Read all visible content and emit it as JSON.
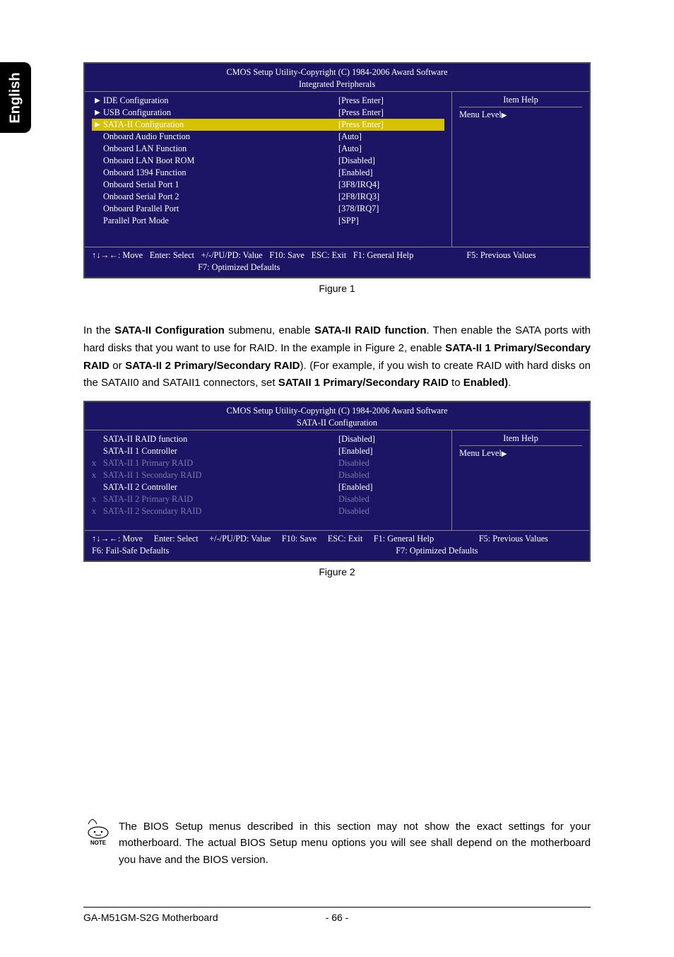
{
  "sideTab": "English",
  "bios1": {
    "title1": "CMOS Setup Utility-Copyright (C) 1984-2006 Award Software",
    "title2": "Integrated Peripherals",
    "rows": [
      {
        "arrow": "▶",
        "label": "IDE Configuration",
        "value": "[Press Enter]"
      },
      {
        "arrow": "▶",
        "label": "USB Configuration",
        "value": "[Press Enter]"
      },
      {
        "arrow": "▶",
        "label": "SATA-II Configuration",
        "value": "[Press Enter]",
        "hl": true
      },
      {
        "arrow": "",
        "label": "Onboard Audio Function",
        "value": "[Auto]"
      },
      {
        "arrow": "",
        "label": "Onboard LAN Function",
        "value": "[Auto]"
      },
      {
        "arrow": "",
        "label": "Onboard LAN Boot ROM",
        "value": "[Disabled]"
      },
      {
        "arrow": "",
        "label": "Onboard 1394 Function",
        "value": "[Enabled]"
      },
      {
        "arrow": "",
        "label": "Onboard Serial Port 1",
        "value": "[3F8/IRQ4]"
      },
      {
        "arrow": "",
        "label": "Onboard Serial Port 2",
        "value": "[2F8/IRQ3]"
      },
      {
        "arrow": "",
        "label": "Onboard Parallel Port",
        "value": "[378/IRQ7]"
      },
      {
        "arrow": "",
        "label": "Parallel Port Mode",
        "value": "[SPP]"
      }
    ],
    "help1": "Item Help",
    "help2": "Menu Level",
    "foot": {
      "move": "↑↓→←: Move",
      "enter": "Enter: Select",
      "pupd": "+/-/PU/PD: Value",
      "f10": "F10: Save",
      "esc": "ESC: Exit",
      "f1": "F1: General Help",
      "f5": "F5: Previous Values",
      "f7": "F7: Optimized Defaults"
    }
  },
  "caption1": "Figure 1",
  "para1": {
    "t1": "In the ",
    "b1": "SATA-II Configuration",
    "t2": " submenu, enable ",
    "b2": "SATA-II RAID function",
    "t3": ". Then enable the SATA ports with hard disks that you want to use for RAID. In the example in Figure 2, enable ",
    "b3": "SATA-II 1 Primary/Secondary RAID",
    "t4": " or ",
    "b4": "SATA-II 2 Primary/Secondary RAID",
    "t5": "). (For example, if you wish to create RAID with hard disks on the SATAII0 and SATAII1 connectors, set ",
    "b5": "SATAII 1 Primary/Secondary RAID",
    "t6": " to ",
    "b6": "Enabled)",
    "t7": "."
  },
  "bios2": {
    "title1": "CMOS Setup Utility-Copyright (C) 1984-2006 Award Software",
    "title2": "SATA-II Configuration",
    "rows": [
      {
        "x": "",
        "label": "SATA-II RAID function",
        "value": "[Disabled]"
      },
      {
        "x": "",
        "label": "SATA-II 1 Controller",
        "value": "[Enabled]"
      },
      {
        "x": "x",
        "label": "SATA-II 1 Primary RAID",
        "value": "Disabled",
        "dim": true
      },
      {
        "x": "x",
        "label": "SATA-II 1 Secondary RAID",
        "value": "Disabled",
        "dim": true
      },
      {
        "x": "",
        "label": "SATA-II 2 Controller",
        "value": "[Enabled]"
      },
      {
        "x": "x",
        "label": "SATA-II 2 Primary RAID",
        "value": "Disabled",
        "dim": true
      },
      {
        "x": "x",
        "label": "SATA-II 2 Secondary RAID",
        "value": "Disabled",
        "dim": true
      }
    ],
    "help1": "Item Help",
    "help2": "Menu Level",
    "foot": {
      "move": "↑↓→←: Move",
      "enter": "Enter: Select",
      "pupd": "+/-/PU/PD: Value",
      "f10": "F10: Save",
      "esc": "ESC: Exit",
      "f1": "F1: General Help",
      "f5": "F5: Previous Values",
      "f6": "F6: Fail-Safe Defaults",
      "f7": "F7: Optimized Defaults"
    }
  },
  "caption2": "Figure 2",
  "noteLabel": "NOTE",
  "noteText": "The BIOS Setup menus described in this section may not show the exact settings for your motherboard. The actual BIOS Setup menu options you will see shall depend on the motherboard you have and the BIOS version.",
  "footer": {
    "left": "GA-M51GM-S2G Motherboard",
    "center": "- 66 -"
  }
}
